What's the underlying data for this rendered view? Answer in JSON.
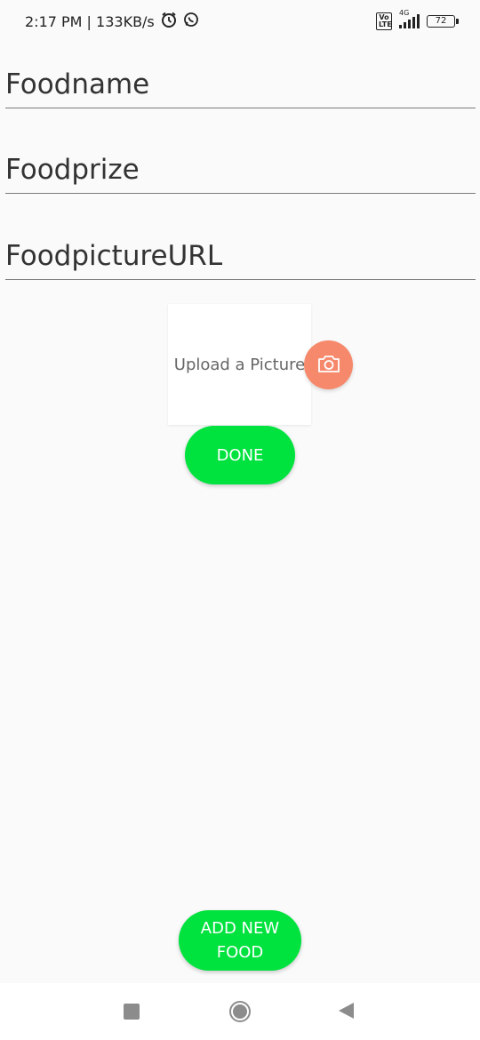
{
  "status_bar": {
    "time_speed": "2:17 PM | 133KB/s",
    "volte": "Vo LTE",
    "network": "4G",
    "battery": "72"
  },
  "form": {
    "food_name_placeholder": "Foodname",
    "food_prize_placeholder": "Foodprize",
    "food_picture_url_placeholder": "FoodpictureURL"
  },
  "upload": {
    "label": "Upload a Picture"
  },
  "buttons": {
    "done": "DONE",
    "add_new_food": "ADD NEW FOOD"
  },
  "colors": {
    "accent_green": "#00e23e",
    "camera_button": "#f6896b"
  },
  "icons": {
    "alarm": "alarm-icon",
    "whatsapp": "whatsapp-icon",
    "camera": "camera-icon",
    "recents": "nav-recents-icon",
    "home": "nav-home-icon",
    "back": "nav-back-icon"
  }
}
